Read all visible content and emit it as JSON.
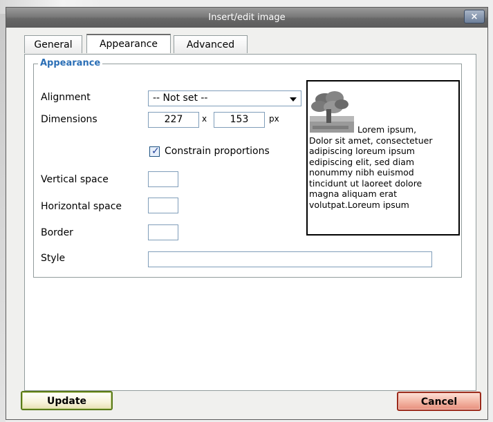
{
  "window": {
    "title": "Insert/edit image",
    "close_glyph": "×"
  },
  "tabs": [
    {
      "label": "General",
      "active": false
    },
    {
      "label": "Appearance",
      "active": true
    },
    {
      "label": "Advanced",
      "active": false
    }
  ],
  "appearance": {
    "legend": "Appearance",
    "alignment": {
      "label": "Alignment",
      "selected": "-- Not set --"
    },
    "dimensions": {
      "label": "Dimensions",
      "width": "227",
      "separator": "x",
      "height": "153",
      "unit": "px"
    },
    "constrain": {
      "label": "Constrain proportions",
      "checked": true
    },
    "vertical_space": {
      "label": "Vertical space",
      "value": ""
    },
    "horizontal_space": {
      "label": "Horizontal space",
      "value": ""
    },
    "border": {
      "label": "Border",
      "value": ""
    },
    "style": {
      "label": "Style",
      "value": ""
    }
  },
  "preview": {
    "text": "Lorem ipsum,\nDolor sit amet, consectetuer adipiscing loreum ipsum edipiscing elit, sed diam nonummy nibh euismod tincidunt ut laoreet dolore magna aliquam erat volutpat.Loreum ipsum"
  },
  "buttons": {
    "update": "Update",
    "cancel": "Cancel"
  },
  "colors": {
    "legend": "#2b6fb6",
    "update_border": "#5a7a1a",
    "cancel_border": "#9b2a1b"
  }
}
